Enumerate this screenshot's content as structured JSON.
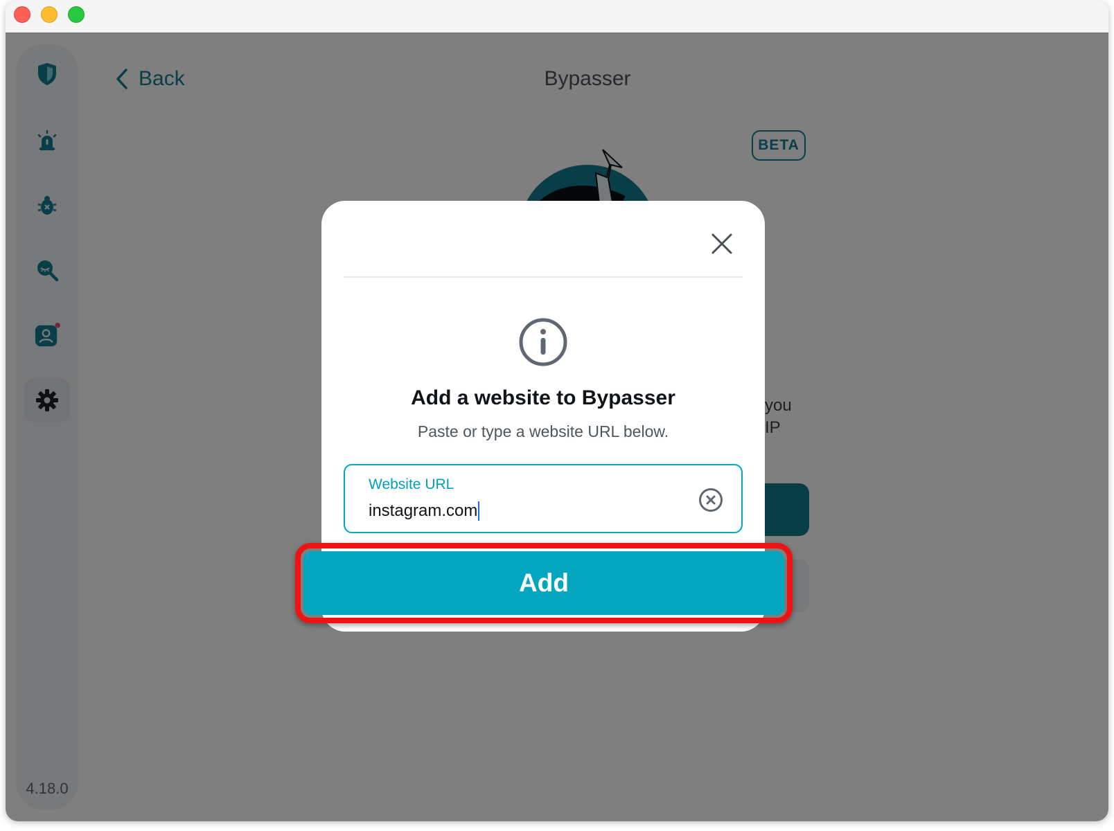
{
  "window": {
    "version": "4.18.0"
  },
  "header": {
    "back_label": "Back",
    "title": "Bypasser",
    "badge": "BETA"
  },
  "background": {
    "text_line1": "you",
    "text_line2": "IP"
  },
  "sidebar": {
    "items": [
      {
        "icon": "shield-icon"
      },
      {
        "icon": "alarm-icon"
      },
      {
        "icon": "bug-icon"
      },
      {
        "icon": "privacy-search-icon"
      },
      {
        "icon": "account-icon",
        "notification_dot": true
      },
      {
        "icon": "gear-icon",
        "selected": true
      }
    ]
  },
  "modal": {
    "title": "Add a website to Bypasser",
    "subtitle": "Paste or type a website URL below.",
    "field_label": "Website URL",
    "field_value": "instagram.com",
    "add_label": "Add"
  },
  "colors": {
    "accent": "#04a5be",
    "brand": "#127b91",
    "highlight": "#ee1212"
  }
}
